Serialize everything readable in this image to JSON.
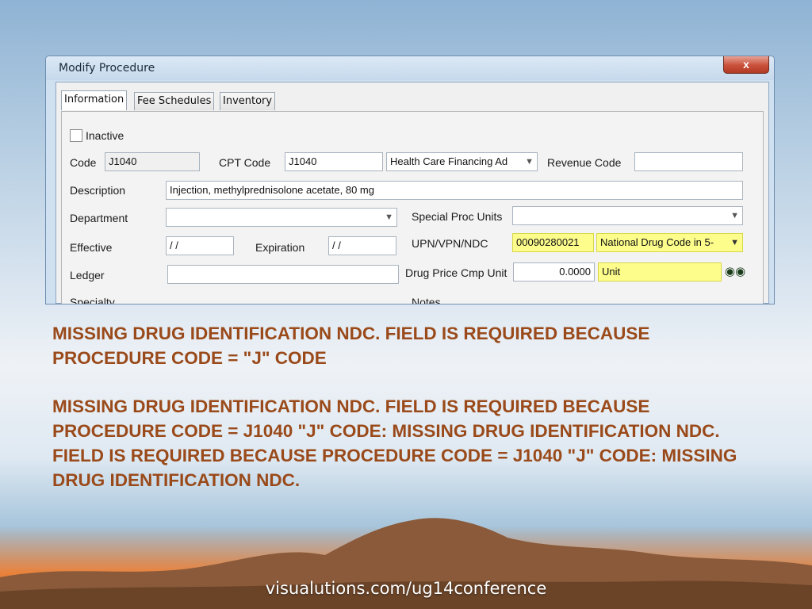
{
  "dialog": {
    "title": "Modify Procedure",
    "close_label": "x",
    "tabs": [
      {
        "label": "Information",
        "active": true
      },
      {
        "label": "Fee Schedules",
        "active": false
      },
      {
        "label": "Inventory",
        "active": false
      }
    ],
    "inactive_label": "Inactive",
    "code_label": "Code",
    "code_value": "J1040",
    "cpt_label": "CPT Code",
    "cpt_value": "J1040",
    "cpt_source": "Health Care Financing Ad",
    "revenue_label": "Revenue Code",
    "revenue_value": "",
    "description_label": "Description",
    "description_value": "Injection, methylprednisolone acetate, 80 mg",
    "department_label": "Department",
    "department_value": "",
    "special_proc_label": "Special Proc Units",
    "special_proc_value": "",
    "effective_label": "Effective",
    "effective_value": "/ /",
    "expiration_label": "Expiration",
    "expiration_value": "/ /",
    "upn_label": "UPN/VPN/NDC",
    "upn_value": "00090280021",
    "upn_type": "National Drug Code in 5-",
    "ledger_label": "Ledger",
    "ledger_value": "",
    "drug_price_label": "Drug Price Cmp Unit",
    "drug_price_value": "0.0000",
    "unit_value": "Unit",
    "specialty_label": "Specialty",
    "notes_label": "Notes"
  },
  "messages": {
    "first": "MISSING DRUG IDENTIFICATION NDC. FIELD IS REQUIRED BECAUSE PROCEDURE CODE  =  \"J\" CODE",
    "second": "MISSING DRUG IDENTIFICATION NDC. FIELD IS REQUIRED BECAUSE PROCEDURE CODE  = J1040 \"J\" CODE: MISSING DRUG IDENTIFICATION NDC. FIELD IS REQUIRED BECAUSE PROCEDURE CODE  = J1040 \"J\" CODE: MISSING DRUG IDENTIFICATION NDC."
  },
  "footer": "visualutions.com/ug14conference",
  "colors": {
    "message": "#9a4a1a",
    "highlight": "#fdfd8c"
  },
  "icons": {
    "search": "binoculars-icon",
    "dropdown": "chevron-down-icon"
  }
}
